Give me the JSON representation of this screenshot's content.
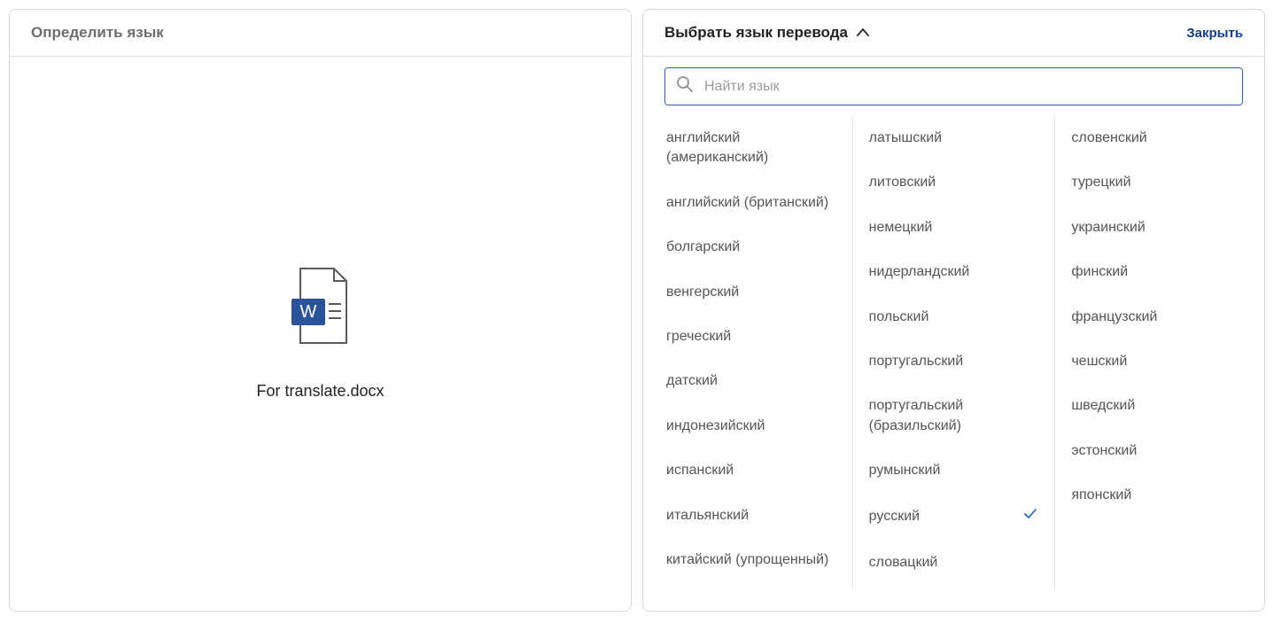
{
  "left_panel": {
    "title": "Определить язык",
    "filename": "For translate.docx"
  },
  "right_panel": {
    "title": "Выбрать язык перевода",
    "close_label": "Закрыть",
    "search_placeholder": "Найти язык",
    "selected_language": "русский",
    "columns": [
      [
        "английский (американский)",
        "английский (британский)",
        "болгарский",
        "венгерский",
        "греческий",
        "датский",
        "индонезийский",
        "испанский",
        "итальянский",
        "китайский (упрощенный)"
      ],
      [
        "латышский",
        "литовский",
        "немецкий",
        "нидерландский",
        "польский",
        "португальский",
        "португальский (бразильский)",
        "румынский",
        "русский",
        "словацкий"
      ],
      [
        "словенский",
        "турецкий",
        "украинский",
        "финский",
        "французский",
        "чешский",
        "шведский",
        "эстонский",
        "японский"
      ]
    ]
  }
}
